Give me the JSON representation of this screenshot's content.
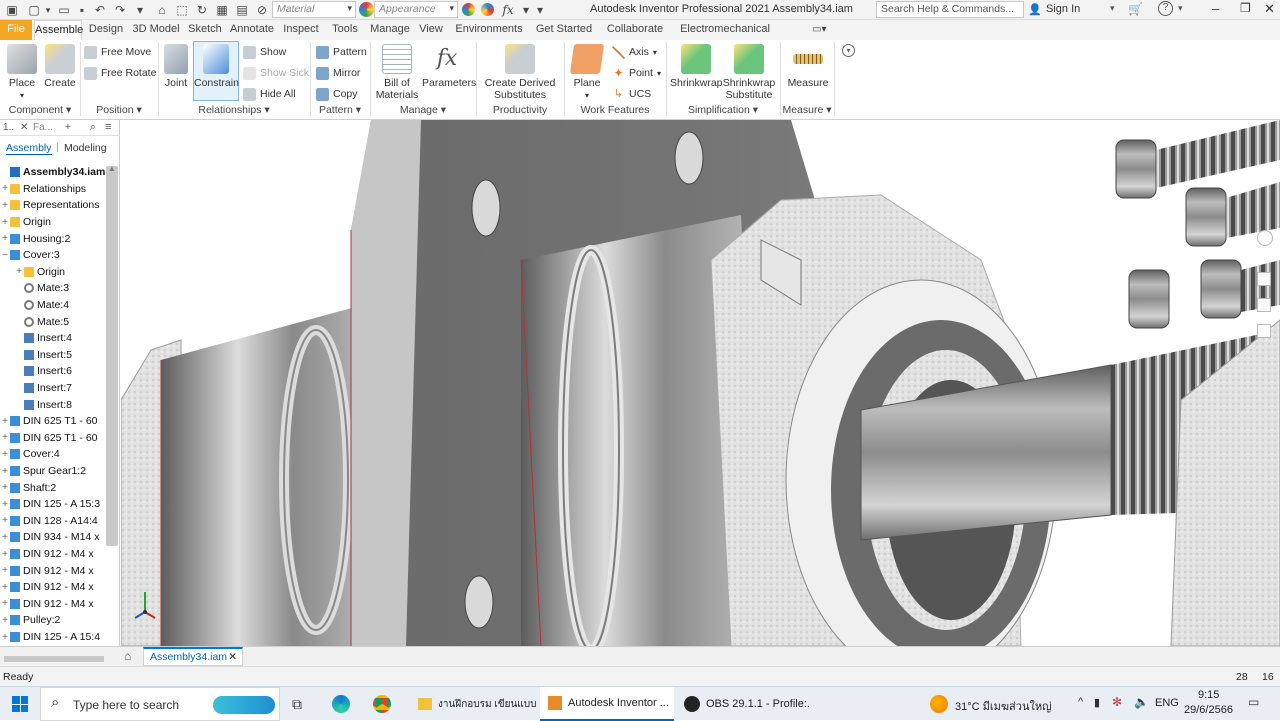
{
  "titlebar": {
    "app_title": "Autodesk Inventor Professional 2021   Assembly34.iam",
    "material_placeholder": "Material",
    "appearance_placeholder": "Appearance",
    "search_placeholder": "Search Help & Commands...",
    "sign_in": "Sign In"
  },
  "tabs": [
    "File",
    "Assemble",
    "Design",
    "3D Model",
    "Sketch",
    "Annotate",
    "Inspect",
    "Tools",
    "Manage",
    "View",
    "Environments",
    "Get Started",
    "Collaborate",
    "Electromechanical"
  ],
  "active_tab": "Assemble",
  "ribbon": {
    "place": "Place",
    "create": "Create",
    "free_move": "Free Move",
    "free_rotate": "Free Rotate",
    "joint": "Joint",
    "constrain": "Constrain",
    "show": "Show",
    "show_sick": "Show Sick",
    "hide_all": "Hide All",
    "pattern": "Pattern",
    "mirror": "Mirror",
    "copy": "Copy",
    "bom_line1": "Bill of",
    "bom_line2": "Materials",
    "parameters": "Parameters",
    "create_derived_line1": "Create Derived",
    "create_derived_line2": "Substitutes",
    "plane": "Plane",
    "axis": "Axis",
    "point": "Point",
    "ucs": "UCS",
    "shrinkwrap": "Shrinkwrap",
    "shrinkwrap_sub_line1": "Shrinkwrap",
    "shrinkwrap_sub_line2": "Substitute",
    "measure": "Measure",
    "groups": {
      "component": "Component",
      "position": "Position",
      "relationships": "Relationships",
      "pattern": "Pattern",
      "manage": "Manage",
      "productivity": "Productivity",
      "work_features": "Work Features",
      "simplification": "Simplification",
      "measure": "Measure"
    }
  },
  "browser": {
    "header_left": "1..",
    "header_search": "Fa...",
    "tab_assembly": "Assembly",
    "tab_modeling": "Modeling",
    "items": [
      {
        "label": "Assembly34.iam",
        "indent": 0,
        "pm": "",
        "bold": true,
        "icon": "assembly"
      },
      {
        "label": "Relationships",
        "indent": 0,
        "pm": "+",
        "icon": "folder"
      },
      {
        "label": "Representations",
        "indent": 0,
        "pm": "+",
        "icon": "folder"
      },
      {
        "label": "Origin",
        "indent": 0,
        "pm": "+",
        "icon": "folder"
      },
      {
        "label": "Housing:2",
        "indent": 0,
        "pm": "+",
        "icon": "part"
      },
      {
        "label": "Cover:3",
        "indent": 0,
        "pm": "−",
        "icon": "part"
      },
      {
        "label": "Origin",
        "indent": 1,
        "pm": "+",
        "icon": "folder"
      },
      {
        "label": "Mate:3",
        "indent": 1,
        "pm": "",
        "icon": "mate"
      },
      {
        "label": "Mate:4",
        "indent": 1,
        "pm": "",
        "icon": "mate"
      },
      {
        "label": "Mate:5",
        "indent": 1,
        "pm": "",
        "icon": "mate"
      },
      {
        "label": "Insert:4",
        "indent": 1,
        "pm": "",
        "icon": "insert"
      },
      {
        "label": "Insert:5",
        "indent": 1,
        "pm": "",
        "icon": "insert"
      },
      {
        "label": "Insert:6",
        "indent": 1,
        "pm": "",
        "icon": "insert"
      },
      {
        "label": "Insert:7",
        "indent": 1,
        "pm": "",
        "icon": "insert"
      },
      {
        "label": "Insert:8",
        "indent": 1,
        "pm": "",
        "icon": "insert"
      },
      {
        "label": "DIN 625 T1 - 60",
        "indent": 0,
        "pm": "+",
        "icon": "part"
      },
      {
        "label": "DIN 625 T1 - 60",
        "indent": 0,
        "pm": "+",
        "icon": "part"
      },
      {
        "label": "Cover:4",
        "indent": 0,
        "pm": "+",
        "icon": "part"
      },
      {
        "label": "Spur Gear1:2",
        "indent": 0,
        "pm": "+",
        "icon": "part"
      },
      {
        "label": "Shaft:2",
        "indent": 0,
        "pm": "+",
        "icon": "part"
      },
      {
        "label": "DIN 125 - A 15:3",
        "indent": 0,
        "pm": "+",
        "icon": "part"
      },
      {
        "label": "DIN 128 - A14:4",
        "indent": 0,
        "pm": "+",
        "icon": "part"
      },
      {
        "label": "DIN 934 - M14 x",
        "indent": 0,
        "pm": "+",
        "icon": "part"
      },
      {
        "label": "DIN 912 - M4 x",
        "indent": 0,
        "pm": "+",
        "icon": "part"
      },
      {
        "label": "DIN 912 - M4 x",
        "indent": 0,
        "pm": "+",
        "icon": "part"
      },
      {
        "label": "DIN 912 - M4 x",
        "indent": 0,
        "pm": "+",
        "icon": "part"
      },
      {
        "label": "DIN 912 - M4 x",
        "indent": 0,
        "pm": "+",
        "icon": "part"
      },
      {
        "label": "Pulley:2",
        "indent": 0,
        "pm": "+",
        "icon": "part"
      },
      {
        "label": "DIN 125 - A 15:4",
        "indent": 0,
        "pm": "+",
        "icon": "part"
      }
    ]
  },
  "doc_tab": "Assembly34.iam",
  "status": {
    "left": "Ready",
    "num1": "28",
    "num2": "16"
  },
  "taskbar": {
    "search_placeholder": "Type here to search",
    "app1": "งานฝึกอบรม เขียนแบบ...",
    "app2": "Autodesk Inventor ...",
    "app3": "OBS 29.1.1 - Profile:...",
    "weather": "31°C  มีเมฆส่วนใหญ่",
    "lang": "ENG",
    "time": "9:15",
    "date": "29/6/2566"
  },
  "colors": {
    "accent": "#0078d7",
    "file_tab": "#f5a623",
    "taskbar": "#e9eef5"
  }
}
